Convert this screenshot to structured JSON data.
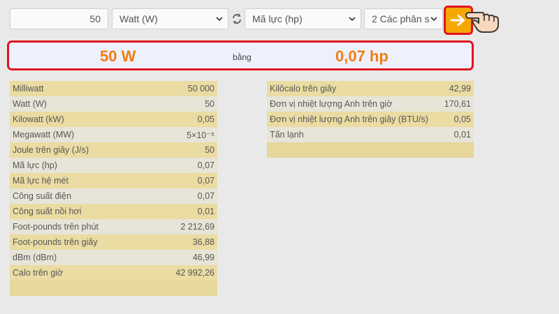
{
  "converter": {
    "amount": "50",
    "from_unit": "Watt (W)",
    "to_unit": "Mã lực (hp)",
    "decimals": "2 Các phân s"
  },
  "icons": {
    "swap": "swap-icon",
    "go": "arrow-right-icon",
    "pointer": "hand-pointer-icon"
  },
  "colors": {
    "accent": "#f07d13",
    "highlight_border": "#e0151f",
    "go_button": "#f5a805"
  },
  "result": {
    "from_text": "50 W",
    "equals": "bằng",
    "to_text": "0,07 hp"
  },
  "left_table": [
    {
      "unit": "Milliwatt",
      "value": "50 000"
    },
    {
      "unit": "Watt (W)",
      "value": "50"
    },
    {
      "unit": "Kilowatt (kW)",
      "value": "0,05"
    },
    {
      "unit": "Megawatt (MW)",
      "value": "5×10⁻⁵"
    },
    {
      "unit": "Joule trên giây (J/s)",
      "value": "50"
    },
    {
      "unit": "Mã lực (hp)",
      "value": "0,07"
    },
    {
      "unit": "Mã lực hệ mét",
      "value": "0,07"
    },
    {
      "unit": "Công suất điện",
      "value": "0,07"
    },
    {
      "unit": "Công suất nồi hơi",
      "value": "0,01"
    },
    {
      "unit": "Foot-pounds trên phút",
      "value": "2 212,69"
    },
    {
      "unit": "Foot-pounds trên giây",
      "value": "36,88"
    },
    {
      "unit": "dBm (dBm)",
      "value": "46,99"
    },
    {
      "unit": "Calo trên giờ",
      "value": "42 992,26"
    }
  ],
  "right_table": [
    {
      "unit": "Kilôcalo trên giây",
      "value": "42,99"
    },
    {
      "unit": "Đơn vị nhiệt lượng Anh trên giờ",
      "value": "170,61"
    },
    {
      "unit": "Đơn vị nhiệt lượng Anh trên giây (BTU/s)",
      "value": "0,05"
    },
    {
      "unit": "Tấn lạnh",
      "value": "0,01"
    }
  ]
}
